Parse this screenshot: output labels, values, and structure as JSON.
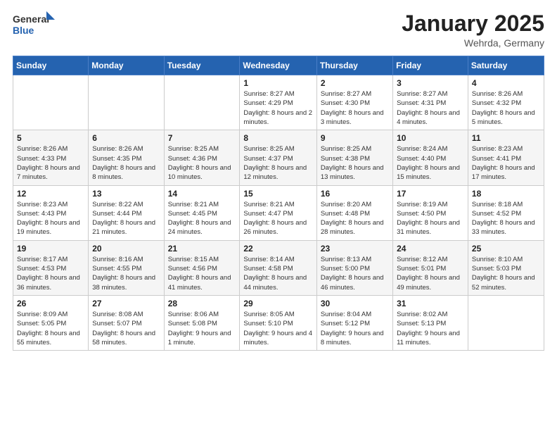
{
  "header": {
    "logo_general": "General",
    "logo_blue": "Blue",
    "month": "January 2025",
    "location": "Wehrda, Germany"
  },
  "weekdays": [
    "Sunday",
    "Monday",
    "Tuesday",
    "Wednesday",
    "Thursday",
    "Friday",
    "Saturday"
  ],
  "weeks": [
    [
      {
        "day": "",
        "info": ""
      },
      {
        "day": "",
        "info": ""
      },
      {
        "day": "",
        "info": ""
      },
      {
        "day": "1",
        "info": "Sunrise: 8:27 AM\nSunset: 4:29 PM\nDaylight: 8 hours\nand 2 minutes."
      },
      {
        "day": "2",
        "info": "Sunrise: 8:27 AM\nSunset: 4:30 PM\nDaylight: 8 hours\nand 3 minutes."
      },
      {
        "day": "3",
        "info": "Sunrise: 8:27 AM\nSunset: 4:31 PM\nDaylight: 8 hours\nand 4 minutes."
      },
      {
        "day": "4",
        "info": "Sunrise: 8:26 AM\nSunset: 4:32 PM\nDaylight: 8 hours\nand 5 minutes."
      }
    ],
    [
      {
        "day": "5",
        "info": "Sunrise: 8:26 AM\nSunset: 4:33 PM\nDaylight: 8 hours\nand 7 minutes."
      },
      {
        "day": "6",
        "info": "Sunrise: 8:26 AM\nSunset: 4:35 PM\nDaylight: 8 hours\nand 8 minutes."
      },
      {
        "day": "7",
        "info": "Sunrise: 8:25 AM\nSunset: 4:36 PM\nDaylight: 8 hours\nand 10 minutes."
      },
      {
        "day": "8",
        "info": "Sunrise: 8:25 AM\nSunset: 4:37 PM\nDaylight: 8 hours\nand 12 minutes."
      },
      {
        "day": "9",
        "info": "Sunrise: 8:25 AM\nSunset: 4:38 PM\nDaylight: 8 hours\nand 13 minutes."
      },
      {
        "day": "10",
        "info": "Sunrise: 8:24 AM\nSunset: 4:40 PM\nDaylight: 8 hours\nand 15 minutes."
      },
      {
        "day": "11",
        "info": "Sunrise: 8:23 AM\nSunset: 4:41 PM\nDaylight: 8 hours\nand 17 minutes."
      }
    ],
    [
      {
        "day": "12",
        "info": "Sunrise: 8:23 AM\nSunset: 4:43 PM\nDaylight: 8 hours\nand 19 minutes."
      },
      {
        "day": "13",
        "info": "Sunrise: 8:22 AM\nSunset: 4:44 PM\nDaylight: 8 hours\nand 21 minutes."
      },
      {
        "day": "14",
        "info": "Sunrise: 8:21 AM\nSunset: 4:45 PM\nDaylight: 8 hours\nand 24 minutes."
      },
      {
        "day": "15",
        "info": "Sunrise: 8:21 AM\nSunset: 4:47 PM\nDaylight: 8 hours\nand 26 minutes."
      },
      {
        "day": "16",
        "info": "Sunrise: 8:20 AM\nSunset: 4:48 PM\nDaylight: 8 hours\nand 28 minutes."
      },
      {
        "day": "17",
        "info": "Sunrise: 8:19 AM\nSunset: 4:50 PM\nDaylight: 8 hours\nand 31 minutes."
      },
      {
        "day": "18",
        "info": "Sunrise: 8:18 AM\nSunset: 4:52 PM\nDaylight: 8 hours\nand 33 minutes."
      }
    ],
    [
      {
        "day": "19",
        "info": "Sunrise: 8:17 AM\nSunset: 4:53 PM\nDaylight: 8 hours\nand 36 minutes."
      },
      {
        "day": "20",
        "info": "Sunrise: 8:16 AM\nSunset: 4:55 PM\nDaylight: 8 hours\nand 38 minutes."
      },
      {
        "day": "21",
        "info": "Sunrise: 8:15 AM\nSunset: 4:56 PM\nDaylight: 8 hours\nand 41 minutes."
      },
      {
        "day": "22",
        "info": "Sunrise: 8:14 AM\nSunset: 4:58 PM\nDaylight: 8 hours\nand 44 minutes."
      },
      {
        "day": "23",
        "info": "Sunrise: 8:13 AM\nSunset: 5:00 PM\nDaylight: 8 hours\nand 46 minutes."
      },
      {
        "day": "24",
        "info": "Sunrise: 8:12 AM\nSunset: 5:01 PM\nDaylight: 8 hours\nand 49 minutes."
      },
      {
        "day": "25",
        "info": "Sunrise: 8:10 AM\nSunset: 5:03 PM\nDaylight: 8 hours\nand 52 minutes."
      }
    ],
    [
      {
        "day": "26",
        "info": "Sunrise: 8:09 AM\nSunset: 5:05 PM\nDaylight: 8 hours\nand 55 minutes."
      },
      {
        "day": "27",
        "info": "Sunrise: 8:08 AM\nSunset: 5:07 PM\nDaylight: 8 hours\nand 58 minutes."
      },
      {
        "day": "28",
        "info": "Sunrise: 8:06 AM\nSunset: 5:08 PM\nDaylight: 9 hours\nand 1 minute."
      },
      {
        "day": "29",
        "info": "Sunrise: 8:05 AM\nSunset: 5:10 PM\nDaylight: 9 hours\nand 4 minutes."
      },
      {
        "day": "30",
        "info": "Sunrise: 8:04 AM\nSunset: 5:12 PM\nDaylight: 9 hours\nand 8 minutes."
      },
      {
        "day": "31",
        "info": "Sunrise: 8:02 AM\nSunset: 5:13 PM\nDaylight: 9 hours\nand 11 minutes."
      },
      {
        "day": "",
        "info": ""
      }
    ]
  ]
}
